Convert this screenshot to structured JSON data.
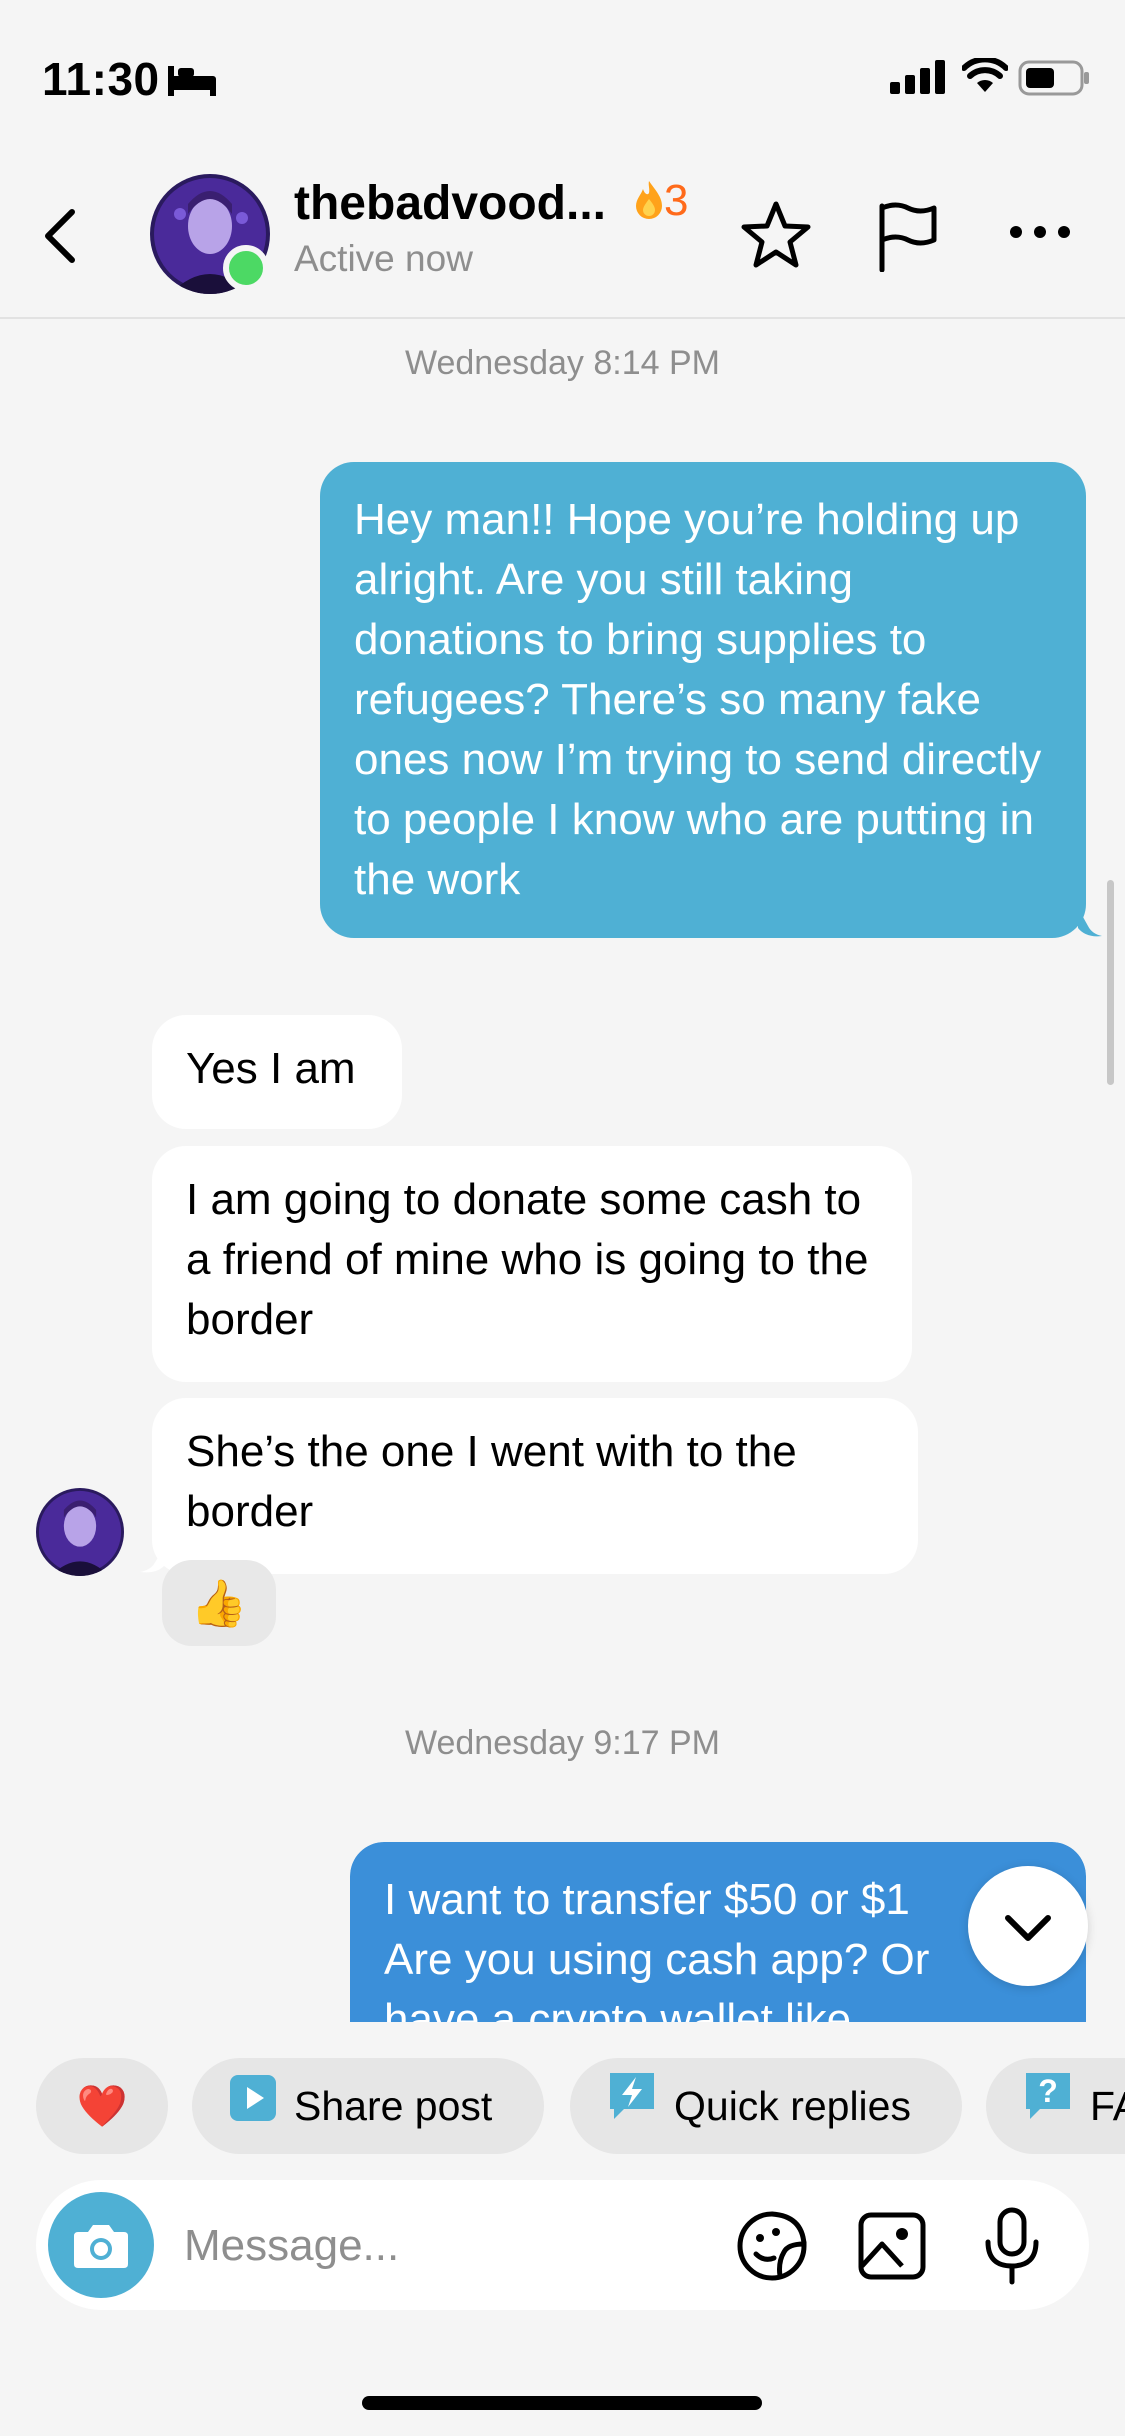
{
  "status_bar": {
    "time": "11:30"
  },
  "header": {
    "username": "thebadvood...",
    "streak": "3",
    "activity": "Active now"
  },
  "timestamps": [
    "Wednesday 8:14 PM",
    "Wednesday 9:17 PM"
  ],
  "messages": {
    "m1": "Hey man!! Hope you’re holding up alright. Are you still taking donations to bring supplies to refugees? There’s so many fake ones now I’m trying to send directly to people I know who are putting in the work",
    "m2": "Yes I am",
    "m3": "I am going to donate some cash to a friend of mine who is going to the border",
    "m4": "She’s the one I went with to the border",
    "m5_line1": "I want to transfer $50 or $1",
    "m5_line2": "Are you using cash app? Or",
    "m5_line3": "have a crypto wallet like"
  },
  "reaction": "👍",
  "quick_actions": {
    "heart": "❤️",
    "share_post": "Share post",
    "quick_replies": "Quick replies",
    "faq": "FAQ"
  },
  "composer": {
    "placeholder": "Message..."
  },
  "colors": {
    "outgoing": "#4fb0d4",
    "outgoing_latest": "#3b8fd9",
    "incoming": "#ffffff",
    "online": "#4cd964",
    "streak": "#ff6a1a"
  },
  "icons": [
    "bed-icon",
    "signal-icon",
    "wifi-icon",
    "battery-icon",
    "back-arrow-icon",
    "star-icon",
    "flag-icon",
    "more-icon",
    "chevron-down-icon",
    "play-icon",
    "lightning-icon",
    "question-icon",
    "camera-icon",
    "sticker-icon",
    "image-icon",
    "microphone-icon"
  ]
}
